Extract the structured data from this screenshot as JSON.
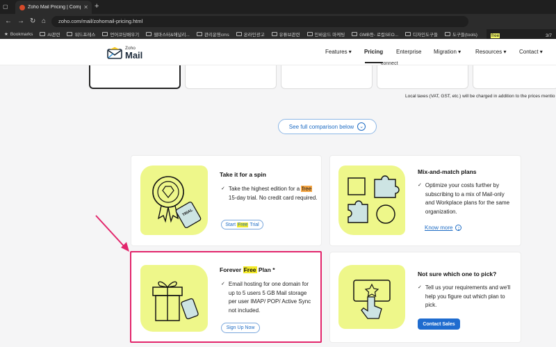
{
  "browser": {
    "tab_title": "Zoho Mail Pricing | Compare",
    "url": "zoho.com/mail/zohomail-pricing.html",
    "bookmarks": [
      "Bookmarks",
      "AI관련",
      "워드프레스",
      "언어코딩배우기",
      "웹마스터&애널리...",
      "관리운영cms",
      "온라인광고",
      "유튜브관련",
      "인바운드 마케팅",
      "GMB등- 로컬SEO...",
      "디자인도구들",
      "도구들(tools)"
    ],
    "find": {
      "query": "free",
      "count": "3/7"
    }
  },
  "site": {
    "logo": {
      "small": "Zoho",
      "big": "Mail"
    },
    "nav": [
      "Features",
      "Pricing",
      "Enterprise",
      "Migration",
      "Resources",
      "Contact"
    ]
  },
  "top": {
    "connect_fragment": "connect",
    "tax_note": "Local taxes (VAT, GST, etc.) will be charged in addition to the prices mentio",
    "compare_button": "See full comparison below"
  },
  "cards": {
    "trial": {
      "title": "Take it for a spin",
      "body_1": "Take the highest edition for a",
      "body_hl": "free",
      "body_2": "15-day trial. No credit card required.",
      "btn_1": "Start",
      "btn_hl": "Free",
      "btn_2": "Trial",
      "badge": "TRIAL"
    },
    "mix": {
      "title": "Mix-and-match plans",
      "body": "Optimize your costs further by subscribing to a mix of Mail-only and Workplace plans for the same organization.",
      "link": "Know more"
    },
    "forever": {
      "title_1": "Forever",
      "title_hl": "Free",
      "title_2": "Plan *",
      "body": "Email hosting for one domain for up to 5 users 5 GB Mail storage per user IMAP/ POP/ Active Sync not included.",
      "btn": "Sign Up Now"
    },
    "unsure": {
      "title": "Not sure which one to pick?",
      "body": "Tell us your requirements and we'll help you figure out which plan to pick.",
      "btn": "Contact Sales"
    }
  },
  "colors": {
    "accent": "#1f6ccf",
    "illustration": "#eef78a",
    "annotation": "#e2256b"
  }
}
